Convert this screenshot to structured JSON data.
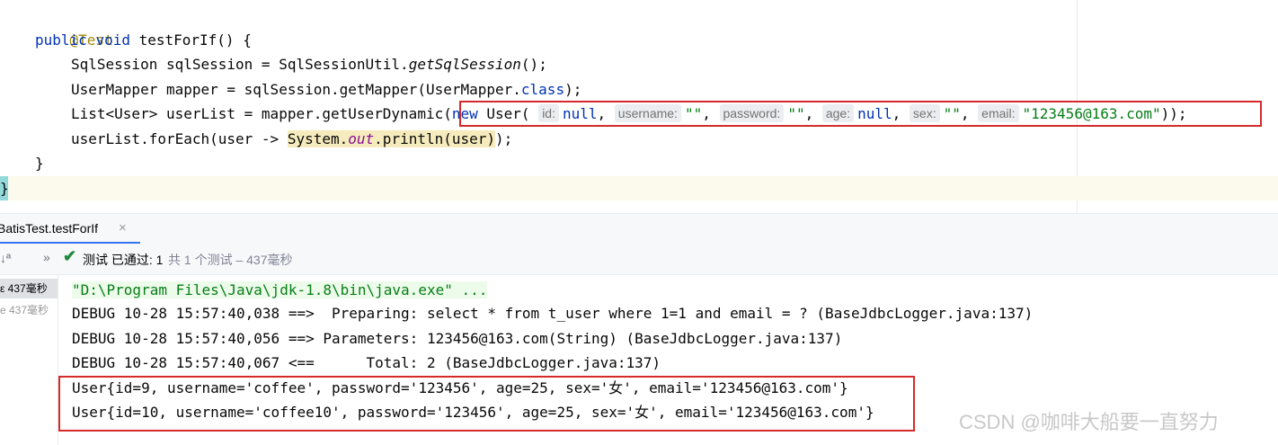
{
  "editor": {
    "annotation": "@Test",
    "method_decl": {
      "public": "public",
      "void": "void",
      "name": " testForIf() {"
    },
    "line3": {
      "a": "SqlSession sqlSession = SqlSessionUtil.",
      "b": "getSqlSession",
      "c": "();"
    },
    "line4": {
      "a": "UserMapper mapper = sqlSession.getMapper(UserMapper.",
      "b": "class",
      "c": ");"
    },
    "line5": {
      "a": "List<User> userList = mapper.getUserDynamic(",
      "new": "new",
      "b": " User( ",
      "hints": {
        "id": "id:",
        "username": "username:",
        "password": "password:",
        "age": "age:",
        "sex": "sex:",
        "email": "email:"
      },
      "null1": "null",
      "comma": ",",
      "empty_str": "\"\"",
      "null2": "null",
      "email_val": "\"123456@163.com\"",
      "end": "));"
    },
    "line6": {
      "a": "userList.forEach(user -> ",
      "sys": "System.",
      "out": "out",
      "println": ".println(user)",
      "end": ");"
    },
    "close_inner": "}",
    "close_outer": "}"
  },
  "run_tab": {
    "title": "BatisTest.testForIf",
    "close": "×"
  },
  "toolbar": {
    "sort_icon": "↓ª",
    "more_icon": "»",
    "check_icon": "✔",
    "status_main": "测试 已通过: 1",
    "status_sub": "共 1 个测试 – 437毫秒"
  },
  "tree": {
    "item1": "ε 437毫秒",
    "item2": "e 437毫秒"
  },
  "console": {
    "cmd": "\"D:\\Program Files\\Java\\jdk-1.8\\bin\\java.exe\" ...",
    "lines": [
      "DEBUG 10-28 15:57:40,038 ==>  Preparing: select * from t_user where 1=1 and email = ? (BaseJdbcLogger.java:137)",
      "DEBUG 10-28 15:57:40,056 ==> Parameters: 123456@163.com(String) (BaseJdbcLogger.java:137)",
      "DEBUG 10-28 15:57:40,067 <==      Total: 2 (BaseJdbcLogger.java:137)"
    ],
    "results": [
      "User{id=9, username='coffee', password='123456', age=25, sex='女', email='123456@163.com'}",
      "User{id=10, username='coffee10', password='123456', age=25, sex='女', email='123456@163.com'}"
    ]
  },
  "watermark": "CSDN @咖啡大船要一直努力",
  "colors": {
    "keyword": "#0033b3",
    "string": "#067d17",
    "annotation": "#9e880d",
    "field": "#871094",
    "highlight_box": "#d52a2a",
    "pass_check": "#208a3c"
  }
}
